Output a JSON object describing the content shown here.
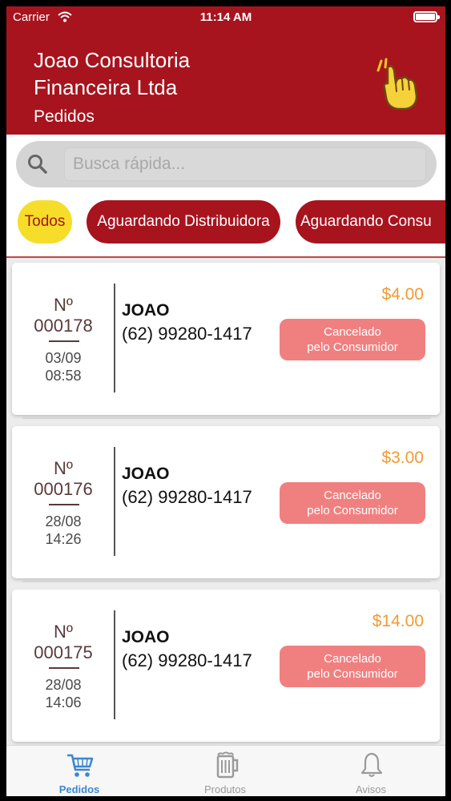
{
  "status_bar": {
    "carrier": "Carrier",
    "time": "11:14 AM"
  },
  "header": {
    "company_line1": "Joao Consultoria",
    "company_line2": "Financeira Ltda",
    "section_title": "Pedidos",
    "icon": "pointing-hand-icon"
  },
  "search": {
    "placeholder": "Busca rápida...",
    "value": ""
  },
  "filters": [
    {
      "label": "Todos",
      "active": true
    },
    {
      "label": "Aguardando Distribuidora",
      "active": false
    },
    {
      "label": "Aguardando Consu",
      "active": false
    }
  ],
  "orders": [
    {
      "prefix": "Nº",
      "number": "000178",
      "date": "03/09",
      "time": "08:58",
      "customer": "JOAO",
      "phone": "(62) 99280-1417",
      "total": "$4.00",
      "status_line1": "Cancelado",
      "status_line2": "pelo Consumidor"
    },
    {
      "prefix": "Nº",
      "number": "000176",
      "date": "28/08",
      "time": "14:26",
      "customer": "JOAO",
      "phone": "(62) 99280-1417",
      "total": "$3.00",
      "status_line1": "Cancelado",
      "status_line2": "pelo Consumidor"
    },
    {
      "prefix": "Nº",
      "number": "000175",
      "date": "28/08",
      "time": "14:06",
      "customer": "JOAO",
      "phone": "(62) 99280-1417",
      "total": "$14.00",
      "status_line1": "Cancelado",
      "status_line2": "pelo Consumidor"
    }
  ],
  "tabs": [
    {
      "label": "Pedidos",
      "icon": "shopping-cart-icon",
      "active": true
    },
    {
      "label": "Produtos",
      "icon": "beer-mug-icon",
      "active": false
    },
    {
      "label": "Avisos",
      "icon": "bell-icon",
      "active": false
    }
  ],
  "colors": {
    "brand_red": "#a7141e",
    "chip_yellow": "#f6dd2a",
    "price_orange": "#f09a35",
    "status_badge": "#f08080",
    "tab_active": "#3b87d1"
  }
}
